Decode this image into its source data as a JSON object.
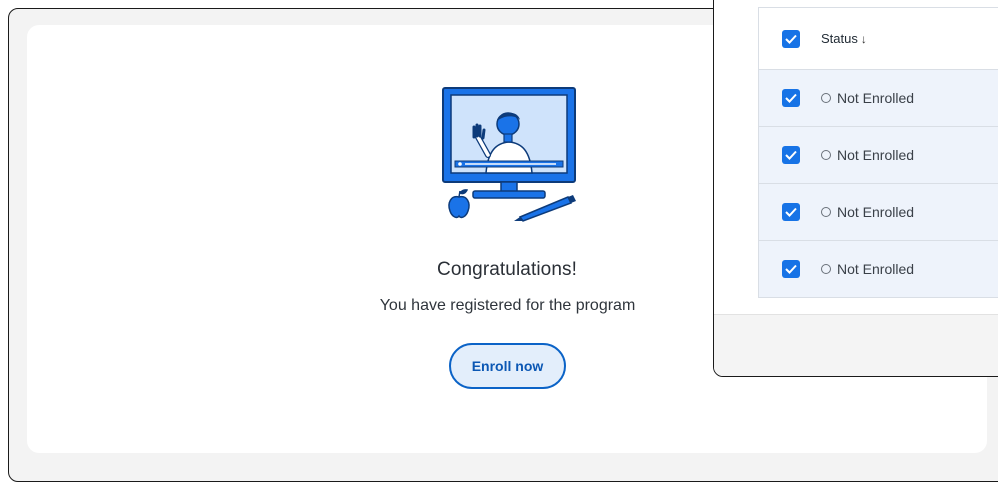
{
  "card": {
    "title": "Congratulations!",
    "message": "You have registered for the program",
    "enroll_label": "Enroll now"
  },
  "table": {
    "header": {
      "label": "Status",
      "sort_icon": "arrow-down-icon",
      "checked": true
    },
    "rows": [
      {
        "status": "Not Enrolled",
        "checked": true
      },
      {
        "status": "Not Enrolled",
        "checked": true
      },
      {
        "status": "Not Enrolled",
        "checked": true
      },
      {
        "status": "Not Enrolled",
        "checked": true
      }
    ]
  },
  "colors": {
    "accent": "#1773e6",
    "button_border": "#0b63c7",
    "button_fill": "#e3eefb",
    "row_fill": "#eef3fb"
  }
}
